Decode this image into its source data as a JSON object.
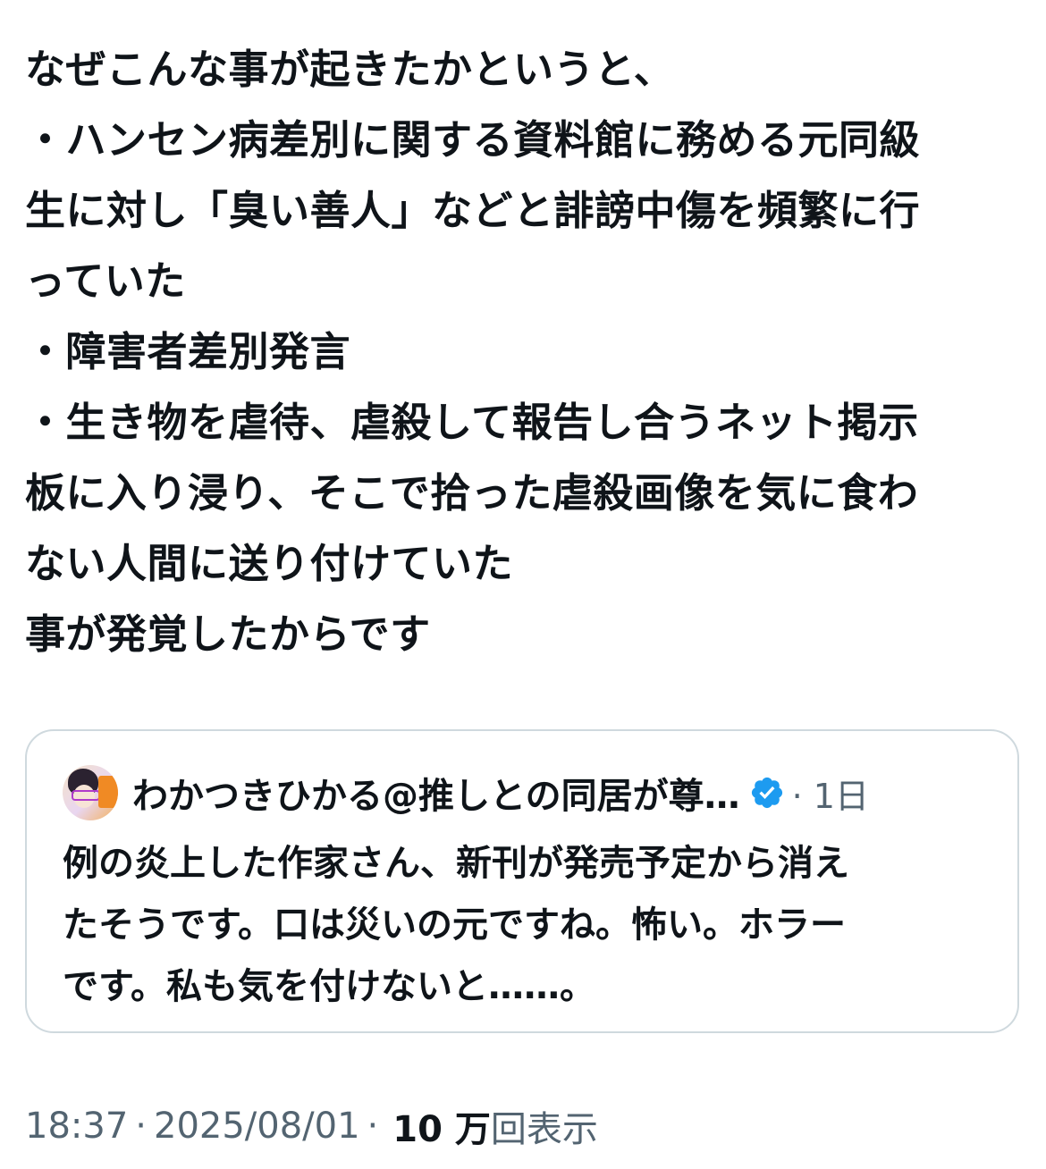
{
  "post": {
    "lines": [
      "なぜこんな事が起きたかというと、",
      "・ハンセン病差別に関する資料館に務める元同級",
      "生に対し「臭い善人」などと誹謗中傷を頻繁に行",
      "っていた",
      "・障害者差別発言",
      "・生き物を虐待、虐殺して報告し合うネット掲示",
      "板に入り浸り、そこで拾った虐殺画像を気に食わ",
      "ない人間に送り付けていた",
      "事が発覚したからです"
    ]
  },
  "quote": {
    "author": "わかつきひかる@推しとの同居が尊…",
    "verified_icon": "verified-badge-icon",
    "verified_color": "#1d9bf0",
    "time": "· 1日",
    "lines": [
      "例の炎上した作家さん、新刊が発売予定から消え",
      "たそうです。口は災いの元ですね。怖い。ホラー",
      "です。私も気を付けないと……。"
    ]
  },
  "meta": {
    "time": "18:37",
    "date": "2025/08/01",
    "separator": "·",
    "views_count": "10 万",
    "views_label": "回表示"
  },
  "colors": {
    "text_primary": "#0f1419",
    "text_secondary": "#536471",
    "border": "#cfd9de"
  }
}
